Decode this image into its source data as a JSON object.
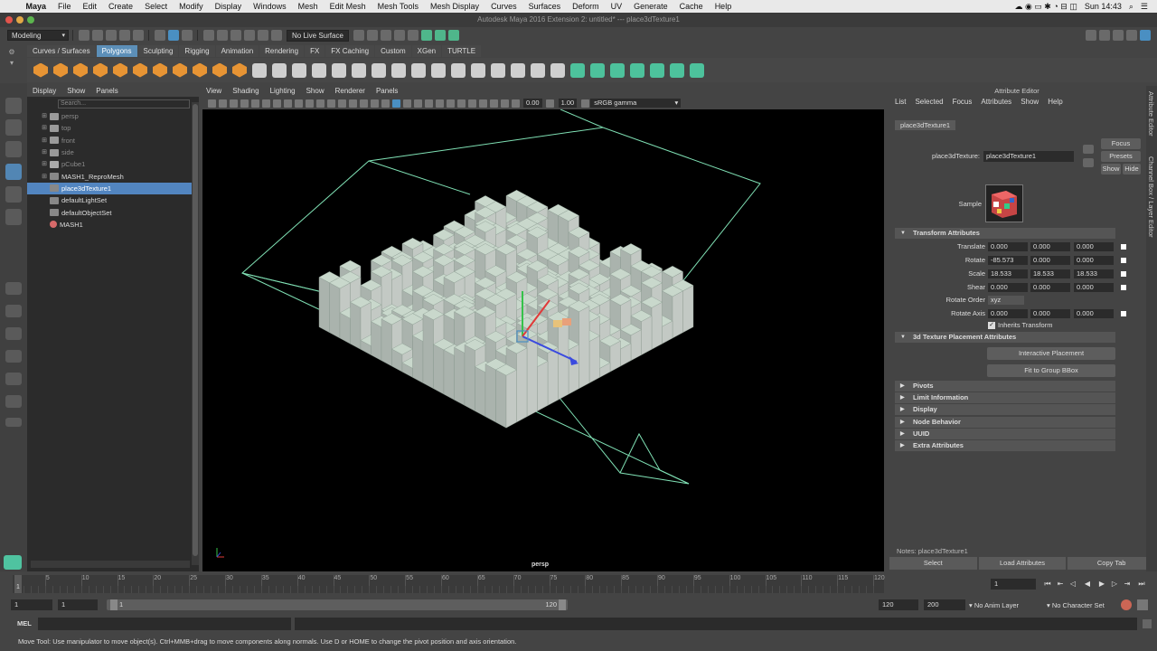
{
  "macbar": {
    "app": "Maya",
    "menus": [
      "File",
      "Edit",
      "Create",
      "Select",
      "Modify",
      "Display",
      "Windows",
      "Mesh",
      "Edit Mesh",
      "Mesh Tools",
      "Mesh Display",
      "Curves",
      "Surfaces",
      "Deform",
      "UV",
      "Generate",
      "Cache",
      "Help"
    ],
    "clock": "Sun 14:43"
  },
  "window": {
    "title": "Autodesk Maya 2016 Extension 2: untitled*   ---   place3dTexture1"
  },
  "statusline": {
    "menuset": "Modeling",
    "live_surface": "No Live Surface"
  },
  "shelf": {
    "tabs": [
      "Curves / Surfaces",
      "Polygons",
      "Sculpting",
      "Rigging",
      "Animation",
      "Rendering",
      "FX",
      "FX Caching",
      "Custom",
      "XGen",
      "TURTLE"
    ],
    "active_tab": "Polygons"
  },
  "outliner": {
    "menu": [
      "Display",
      "Show",
      "Panels"
    ],
    "search_placeholder": "Search...",
    "items": [
      {
        "label": "persp",
        "dim": true
      },
      {
        "label": "top",
        "dim": true
      },
      {
        "label": "front",
        "dim": true
      },
      {
        "label": "side",
        "dim": true
      },
      {
        "label": "pCube1",
        "dim": true
      },
      {
        "label": "MASH1_ReproMesh",
        "dim": false
      },
      {
        "label": "place3dTexture1",
        "dim": false,
        "selected": true
      },
      {
        "label": "defaultLightSet",
        "dim": false
      },
      {
        "label": "defaultObjectSet",
        "dim": false
      },
      {
        "label": "MASH1",
        "dim": false
      }
    ]
  },
  "viewport": {
    "menu": [
      "View",
      "Shading",
      "Lighting",
      "Show",
      "Renderer",
      "Panels"
    ],
    "exposure": "0.00",
    "gamma": "1.00",
    "color_space": "sRGB gamma",
    "camera_label": "persp",
    "colors": {
      "background": "#000000",
      "manipulator": "#7fe0b4",
      "cubes": "#c9d8cc"
    }
  },
  "attribute_editor": {
    "title": "Attribute Editor",
    "menu": [
      "List",
      "Selected",
      "Focus",
      "Attributes",
      "Show",
      "Help"
    ],
    "node_tab": "place3dTexture1",
    "node_label": "place3dTexture:",
    "node_name": "place3dTexture1",
    "buttons": {
      "focus": "Focus",
      "presets": "Presets",
      "show": "Show",
      "hide": "Hide"
    },
    "sample_label": "Sample",
    "transform_section": "Transform Attributes",
    "translate": {
      "label": "Translate",
      "values": [
        "0.000",
        "0.000",
        "0.000"
      ]
    },
    "rotate": {
      "label": "Rotate",
      "values": [
        "-85.573",
        "0.000",
        "0.000"
      ]
    },
    "scale": {
      "label": "Scale",
      "values": [
        "18.533",
        "18.533",
        "18.533"
      ]
    },
    "shear": {
      "label": "Shear",
      "values": [
        "0.000",
        "0.000",
        "0.000"
      ]
    },
    "rotate_order": {
      "label": "Rotate Order",
      "value": "xyz"
    },
    "rotate_axis": {
      "label": "Rotate Axis",
      "values": [
        "0.000",
        "0.000",
        "0.000"
      ]
    },
    "inherits_transform": "Inherits Transform",
    "placement_section": "3d Texture Placement Attributes",
    "interactive_placement": "Interactive Placement",
    "fit_bbox": "Fit to Group BBox",
    "sections": [
      "Pivots",
      "Limit Information",
      "Display",
      "Node Behavior",
      "UUID",
      "Extra Attributes"
    ],
    "notes": "Notes: place3dTexture1",
    "bottom_buttons": [
      "Select",
      "Load Attributes",
      "Copy Tab"
    ],
    "side_tabs": [
      "Attribute Editor",
      "Channel Box / Layer Editor"
    ]
  },
  "timeline": {
    "ticks": [
      "1",
      "5",
      "10",
      "15",
      "20",
      "25",
      "30",
      "35",
      "40",
      "45",
      "50",
      "55",
      "60",
      "65",
      "70",
      "75",
      "80",
      "85",
      "90",
      "95",
      "100",
      "105",
      "110",
      "115",
      "120"
    ],
    "current_frame": "1",
    "field_current": "1"
  },
  "range": {
    "start": "1",
    "anim_start": "1",
    "range_start": "1",
    "range_end": "120",
    "anim_end_a": "120",
    "anim_end_b": "200",
    "anim_layer": "No Anim Layer",
    "character_set": "No Character Set"
  },
  "command": {
    "label": "MEL"
  },
  "help_line": "Move Tool: Use manipulator to move object(s). Ctrl+MMB+drag to move components along normals. Use D or HOME to change the pivot position and axis orientation."
}
